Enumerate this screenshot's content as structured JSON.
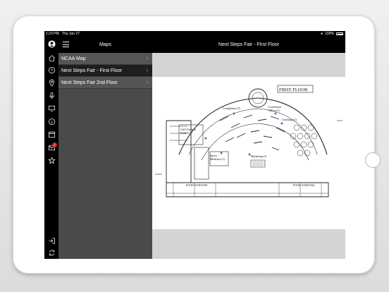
{
  "status": {
    "time": "1:23 PM",
    "date": "Thu Jun 27",
    "battery": "100%"
  },
  "sidebar": {
    "title": "Maps",
    "items": [
      {
        "label": "NCAA Map"
      },
      {
        "label": "Next Steps Fair - First Floor"
      },
      {
        "label": "Next Steps Fair 2nd Floor"
      }
    ],
    "badge_count": "2"
  },
  "content": {
    "title": "Next Steps Fair - First Floor"
  },
  "icons": [
    "profile-icon",
    "hamburger-icon",
    "home-icon",
    "clock-icon",
    "location-pin-icon",
    "microphone-icon",
    "monitor-icon",
    "info-icon",
    "calendar-icon",
    "mail-icon",
    "star-icon",
    "logout-icon",
    "sync-icon",
    "chevron-right-icon"
  ],
  "map": {
    "floor_label": "FIRST FLOOR",
    "rooms": [
      {
        "label": "Compliance (1)"
      },
      {
        "label": "Conference"
      },
      {
        "label": "Office (1)"
      },
      {
        "label": "Coaching (1)"
      },
      {
        "label": "USA Track &"
      },
      {
        "label": "Field (1)"
      },
      {
        "label": "Sports"
      },
      {
        "label": "Medicine (1)"
      },
      {
        "label": "Marketing (1)"
      },
      {
        "label": "FOOD STATIONS"
      },
      {
        "label": "FOOD STATIONS"
      }
    ]
  }
}
